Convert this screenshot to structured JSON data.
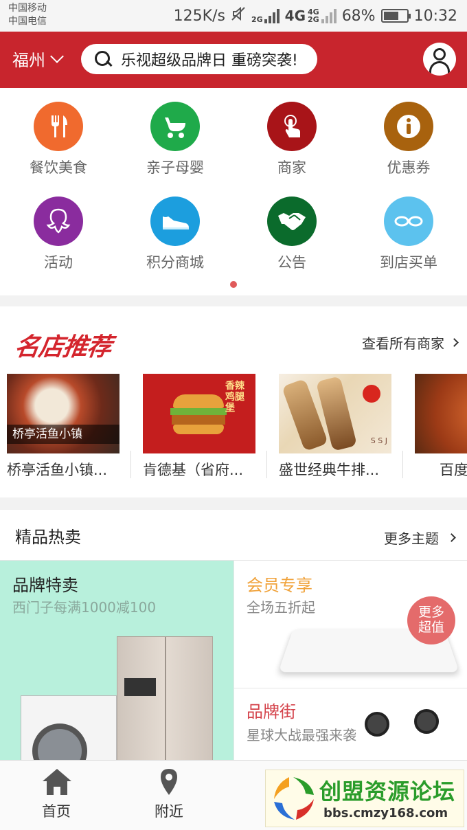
{
  "status_bar": {
    "carrier1": "中国移动",
    "carrier2": "中国电信",
    "speed": "125K/s",
    "net1": "2G",
    "net2": "4G",
    "net3a": "4G",
    "net3b": "2G",
    "battery": "68%",
    "battery_level": 0.68,
    "time": "10:32"
  },
  "header": {
    "city": "福州",
    "search_text": "乐视超级品牌日 重磅突袭!"
  },
  "categories": [
    {
      "label": "餐饮美食",
      "color": "#f06a2e",
      "icon": "fork-knife-icon"
    },
    {
      "label": "亲子母婴",
      "color": "#1faa4a",
      "icon": "stroller-icon"
    },
    {
      "label": "商家",
      "color": "#a81418",
      "icon": "touch-icon"
    },
    {
      "label": "优惠券",
      "color": "#a8620e",
      "icon": "info-icon"
    },
    {
      "label": "活动",
      "color": "#8a2c9e",
      "icon": "octopus-icon"
    },
    {
      "label": "积分商城",
      "color": "#1c9ede",
      "icon": "shoe-icon"
    },
    {
      "label": "公告",
      "color": "#0b6b2c",
      "icon": "handshake-icon"
    },
    {
      "label": "到店买单",
      "color": "#5cc2ee",
      "icon": "glasses-icon"
    }
  ],
  "stores": {
    "logo_text": "名店推荐",
    "view_all": "查看所有商家",
    "items": [
      {
        "name": "桥亭活鱼小镇...",
        "overlay": "桥亭活鱼小镇"
      },
      {
        "name": "肯德基（省府...",
        "overlay": "香辣鸡腿堡"
      },
      {
        "name": "盛世经典牛排...",
        "overlay": "S S J"
      },
      {
        "name": "百度",
        "overlay": ""
      }
    ]
  },
  "hot": {
    "title": "精品热卖",
    "more": "更多主题",
    "brand_sale": {
      "title": "品牌特卖",
      "subtitle": "西门子每满1000减100"
    },
    "member": {
      "title": "会员专享",
      "subtitle": "全场五折起",
      "badge": "更多超值"
    },
    "brand_street": {
      "title": "品牌街",
      "subtitle": "星球大战最强来袭"
    }
  },
  "bottom_nav": {
    "home": "首页",
    "nearby": "附近"
  },
  "watermark": {
    "title": "创盟资源论坛",
    "url": "bbs.cmzy168.com"
  },
  "colors": {
    "brand_red": "#c8252d",
    "mint": "#b8f0dc",
    "member_orange": "#f0a23a",
    "street_red": "#d4424a"
  }
}
